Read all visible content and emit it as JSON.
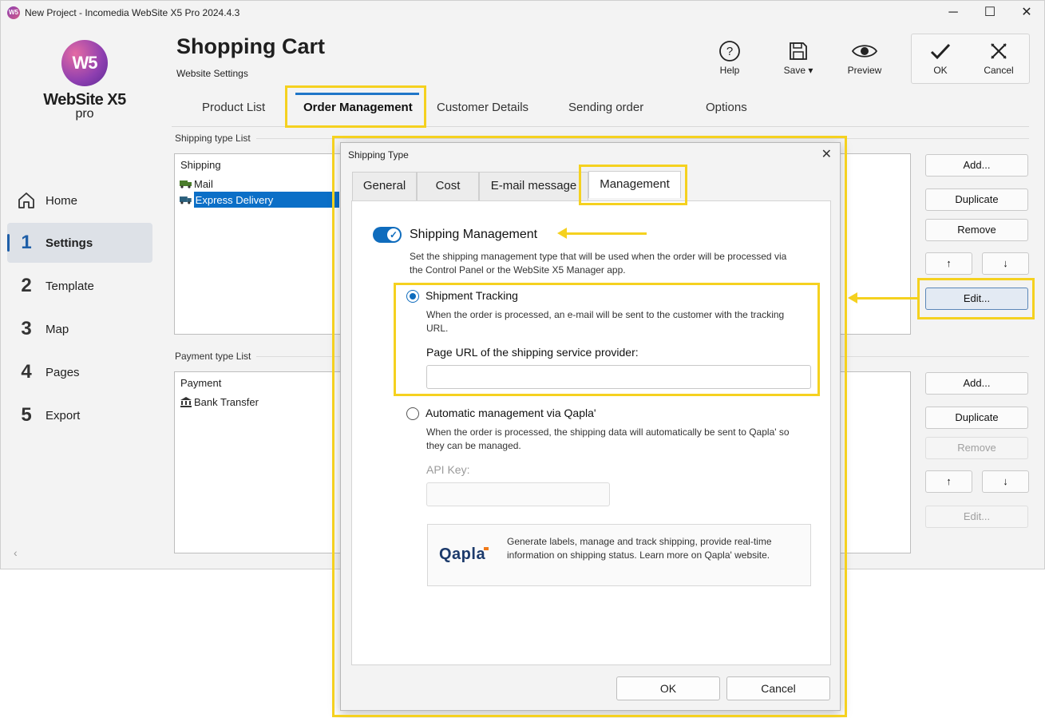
{
  "window": {
    "title": "New Project - Incomedia WebSite X5 Pro 2024.4.3",
    "app_icon": "W5"
  },
  "logo": {
    "orb_text": "W5",
    "name": "WebSite X5",
    "edition": "pro"
  },
  "sidebar": {
    "items": [
      {
        "num": "",
        "label": "Home",
        "icon": "home-icon"
      },
      {
        "num": "1",
        "label": "Settings",
        "active": true
      },
      {
        "num": "2",
        "label": "Template"
      },
      {
        "num": "3",
        "label": "Map"
      },
      {
        "num": "4",
        "label": "Pages"
      },
      {
        "num": "5",
        "label": "Export"
      }
    ],
    "collapse_glyph": "‹"
  },
  "header": {
    "title": "Shopping Cart",
    "subtitle": "Website Settings"
  },
  "toolbar": {
    "help_label": "Help",
    "save_label": "Save ▾",
    "preview_label": "Preview",
    "ok_label": "OK",
    "cancel_label": "Cancel"
  },
  "tabs": [
    "Product List",
    "Order Management",
    "Customer Details",
    "Sending order",
    "Options"
  ],
  "shipping": {
    "section_label": "Shipping type List",
    "header": "Shipping",
    "rows": [
      "Mail",
      "Express Delivery"
    ],
    "buttons": {
      "add": "Add...",
      "duplicate": "Duplicate",
      "remove": "Remove",
      "up": "↑",
      "down": "↓",
      "edit": "Edit..."
    }
  },
  "payment": {
    "section_label": "Payment type List",
    "header": "Payment",
    "rows": [
      "Bank Transfer"
    ],
    "buttons": {
      "add": "Add...",
      "duplicate": "Duplicate",
      "remove": "Remove",
      "up": "↑",
      "down": "↓",
      "edit": "Edit..."
    }
  },
  "dialog": {
    "title": "Shipping Type",
    "close": "✕",
    "tabs": [
      "General",
      "Cost",
      "E-mail message",
      "Management"
    ],
    "toggle_label": "Shipping Management",
    "toggle_on": true,
    "description": "Set the shipping management type that will be used when the order will be processed via the Control Panel or the WebSite X5 Manager app.",
    "option1": {
      "label": "Shipment Tracking",
      "selected": true,
      "description": "When the order is processed, an e-mail will be sent to the customer with the tracking URL.",
      "field_label": "Page URL of the shipping service provider:",
      "field_value": ""
    },
    "option2": {
      "label": "Automatic management via Qapla'",
      "selected": false,
      "description": "When the order is processed, the shipping data will automatically be sent to Qapla' so they can be managed.",
      "field_label": "API Key:",
      "field_value": ""
    },
    "qapla": {
      "logo": "Qapla",
      "text": "Generate labels, manage and track shipping, provide real-time information on shipping status. Learn more on Qapla' website."
    },
    "ok": "OK",
    "cancel": "Cancel"
  },
  "colors": {
    "accent": "#0f6cbd",
    "highlight": "#f5d11f",
    "selection": "#0b6fc7"
  }
}
